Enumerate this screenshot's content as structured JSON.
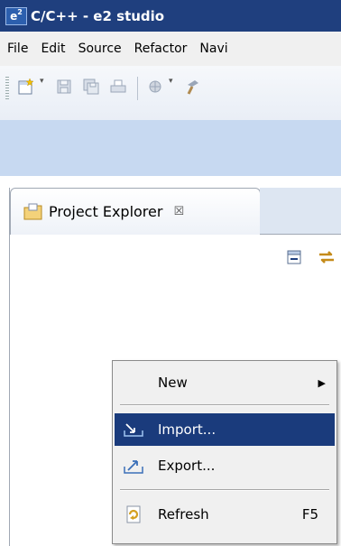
{
  "window": {
    "title": "C/C++ - e2 studio",
    "app_icon_text": "e",
    "app_icon_sup": "2"
  },
  "menubar": {
    "items": [
      "File",
      "Edit",
      "Source",
      "Refactor",
      "Navi"
    ]
  },
  "toolbar": {
    "icons": [
      "new-wizard-icon",
      "save-icon",
      "save-all-icon",
      "print-icon",
      "debug-icon",
      "build-icon"
    ],
    "dropdown_glyph": "▾"
  },
  "view": {
    "title": "Project Explorer",
    "close_glyph": "☒",
    "toolbar_icons": [
      "collapse-all-icon",
      "link-with-editor-icon"
    ]
  },
  "context_menu": {
    "new": {
      "label": "New",
      "submenu_glyph": "▶"
    },
    "import": {
      "label": "Import..."
    },
    "export": {
      "label": "Export..."
    },
    "refresh": {
      "label": "Refresh",
      "shortcut": "F5"
    }
  },
  "colors": {
    "title_bar": "#1f3f7e",
    "menu_bar": "#f0f0f0",
    "band": "#c7d9f1",
    "selection": "#1a3b7c"
  }
}
